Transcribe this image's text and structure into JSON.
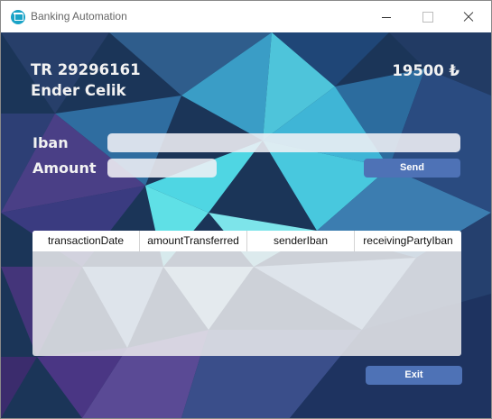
{
  "window": {
    "title": "Banking Automation"
  },
  "account": {
    "number": "TR 29296161",
    "owner": "Ender Celik",
    "balance": "19500 ₺"
  },
  "form": {
    "iban_label": "Iban",
    "iban_value": "",
    "amount_label": "Amount",
    "amount_value": "",
    "send_label": "Send"
  },
  "table": {
    "columns": [
      "transactionDate",
      "amountTransferred",
      "senderIban",
      "receivingPartyIban"
    ],
    "rows": []
  },
  "footer": {
    "exit_label": "Exit"
  },
  "colors": {
    "button": "#4e72b6",
    "background_primary": "#1b3558",
    "accent": "#3fd6e0"
  },
  "icons": {
    "app": "bank-icon"
  }
}
